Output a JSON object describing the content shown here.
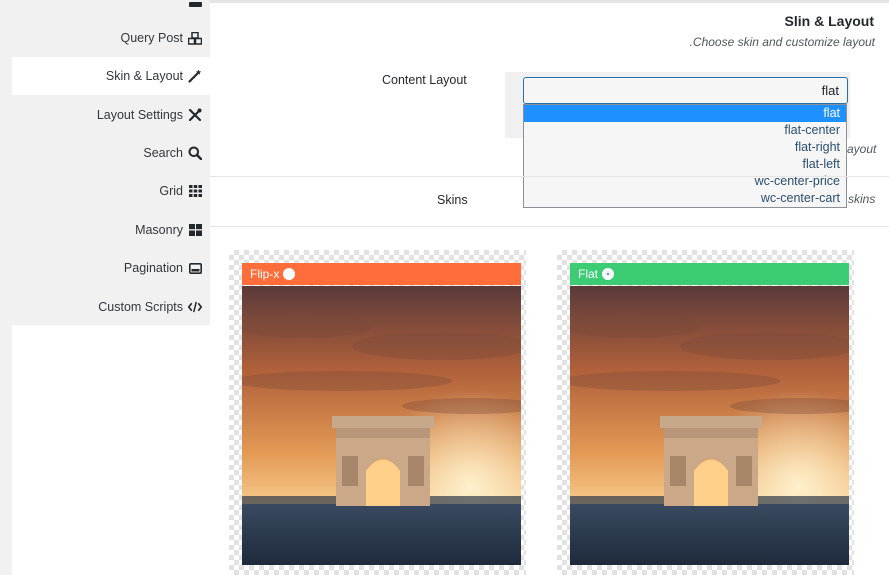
{
  "sidebar": {
    "items": [
      {
        "label": "Query Post",
        "icon": "cubes-icon"
      },
      {
        "label": "Skin & Layout",
        "icon": "magic-wand-icon",
        "active": true
      },
      {
        "label": "Layout Settings",
        "icon": "tools-icon"
      },
      {
        "label": "Search",
        "icon": "search-icon"
      },
      {
        "label": "Grid",
        "icon": "grid-icon"
      },
      {
        "label": "Masonry",
        "icon": "masonry-icon"
      },
      {
        "label": "Pagination",
        "icon": "pagination-icon"
      },
      {
        "label": "Custom Scripts",
        "icon": "code-icon"
      }
    ]
  },
  "section": {
    "title": "Slin & Layout",
    "subtitle": ".Choose skin and customize layout"
  },
  "content_layout": {
    "label": "Content Layout",
    "selected": "flat",
    "options": [
      "flat",
      "flat-center",
      "flat-right",
      "flat-left",
      "wc-center-price",
      "wc-center-cart"
    ],
    "hint_partial": "ayout"
  },
  "skins": {
    "label": "Skins",
    "hint_partial": "skins",
    "cards": [
      {
        "name": "Flip-x",
        "color": "#ff6d3b",
        "checked": false
      },
      {
        "name": "Flat",
        "color": "#3ccc74",
        "checked": true
      }
    ]
  }
}
